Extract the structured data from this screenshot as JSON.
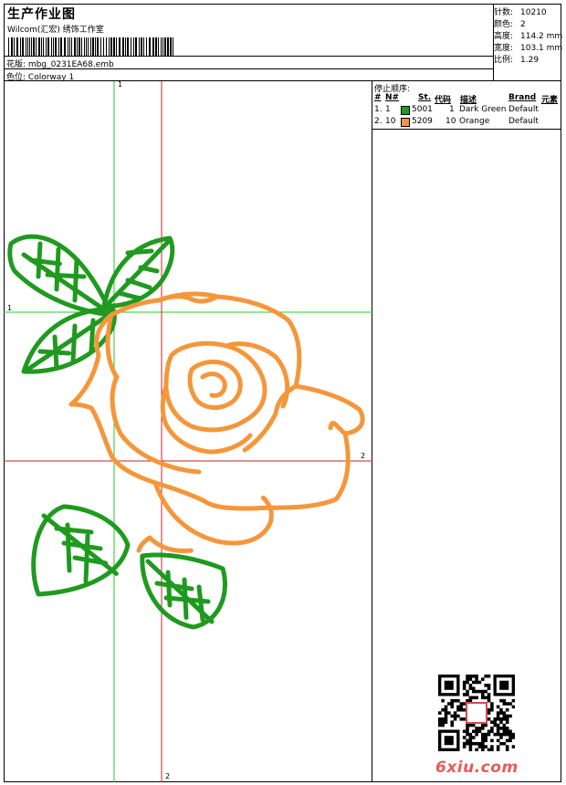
{
  "header": {
    "title": "生产作业图",
    "subtitle": "Wilcom(汇宏) 绣饰工作室",
    "design_label": "花版:",
    "design_value": "mbg_0231EA68.emb",
    "colorway_label": "色位:",
    "colorway_value": "Colorway 1"
  },
  "stats": [
    {
      "label": "针数:",
      "value": "10210"
    },
    {
      "label": "颜色:",
      "value": "2"
    },
    {
      "label": "高度:",
      "value": "114.2 mm"
    },
    {
      "label": "宽度:",
      "value": "103.1 mm"
    },
    {
      "label": "比例:",
      "value": "1.29"
    }
  ],
  "stop_panel": {
    "title": "停止顺序:",
    "columns": {
      "num": "#",
      "needle": "N#",
      "st": "St.",
      "code": "代码",
      "desc": "描述",
      "brand": "Brand",
      "element": "元素"
    },
    "rows": [
      {
        "num": "1.",
        "needle": "1",
        "color": "#1f9a1f",
        "code": "5001",
        "st": "1",
        "desc": "Dark Green",
        "brand": "Default"
      },
      {
        "num": "2.",
        "needle": "10",
        "color": "#f5963a",
        "code": "5209",
        "st": "10",
        "desc": "Orange",
        "brand": "Default"
      }
    ]
  },
  "guides": {
    "vertical_green": "1",
    "horizontal_green": "1",
    "horizontal_red": "2",
    "vertical_red": "2"
  },
  "colors": {
    "green_guide": "#22cc22",
    "red_guide": "#cc2222",
    "leaf": "#1f9a1f",
    "rose": "#f5963a"
  },
  "watermark": "6xiu.com"
}
